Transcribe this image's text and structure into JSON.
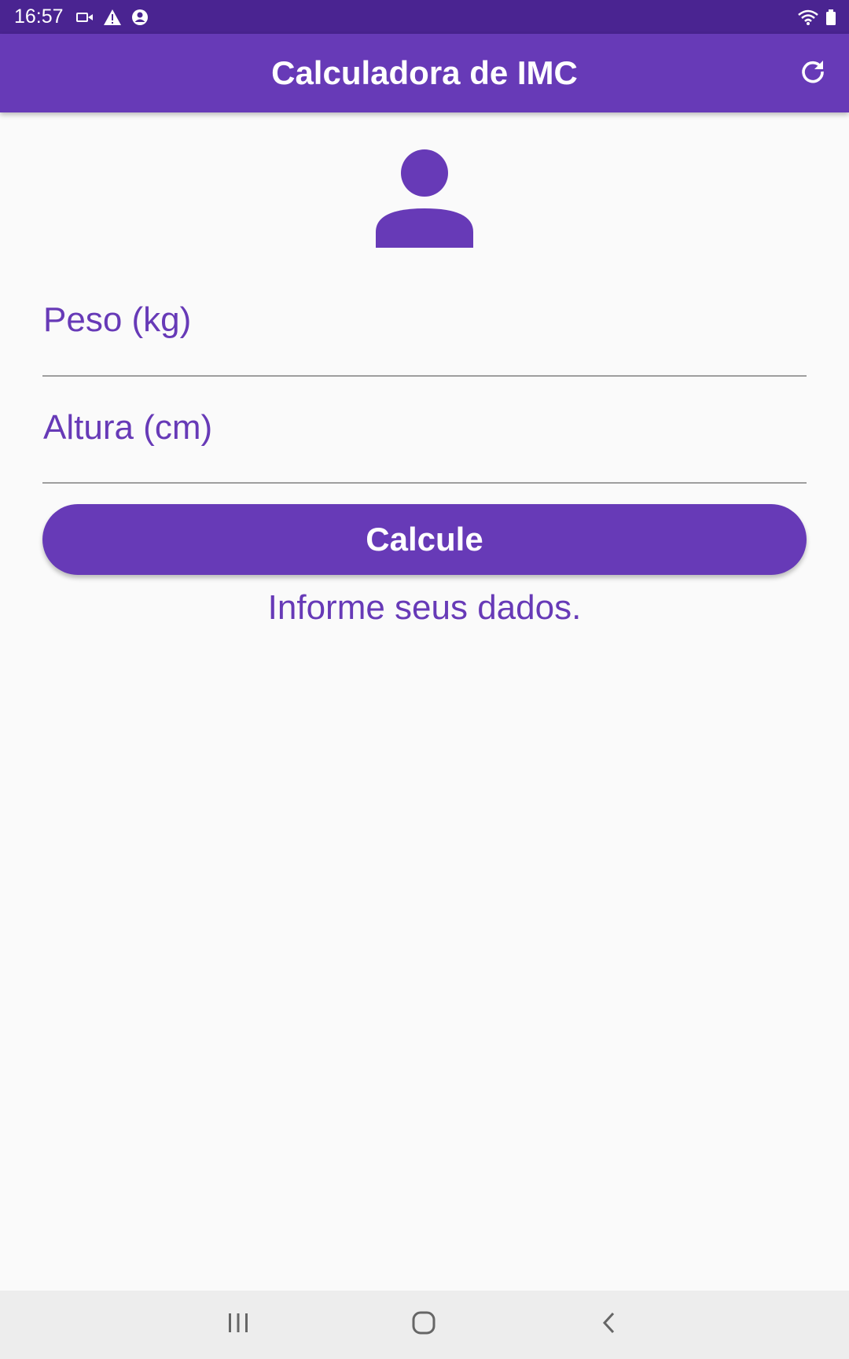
{
  "status_bar": {
    "time": "16:57",
    "icons": [
      "video-camera-icon",
      "warning-icon",
      "account-icon",
      "wifi-icon",
      "battery-icon"
    ]
  },
  "app_bar": {
    "title": "Calculadora de IMC",
    "action_icon": "refresh-icon"
  },
  "form": {
    "header_icon": "person-icon",
    "weight_label": "Peso (kg)",
    "height_label": "Altura (cm)",
    "submit_label": "Calcule",
    "info_text": "Informe seus dados."
  },
  "nav_bar": {
    "icons": [
      "recents-icon",
      "home-icon",
      "back-icon"
    ]
  },
  "colors": {
    "status_bar": "#4a2491",
    "primary": "#673ab7",
    "background": "#fafafa",
    "nav_bar": "#ededed"
  }
}
